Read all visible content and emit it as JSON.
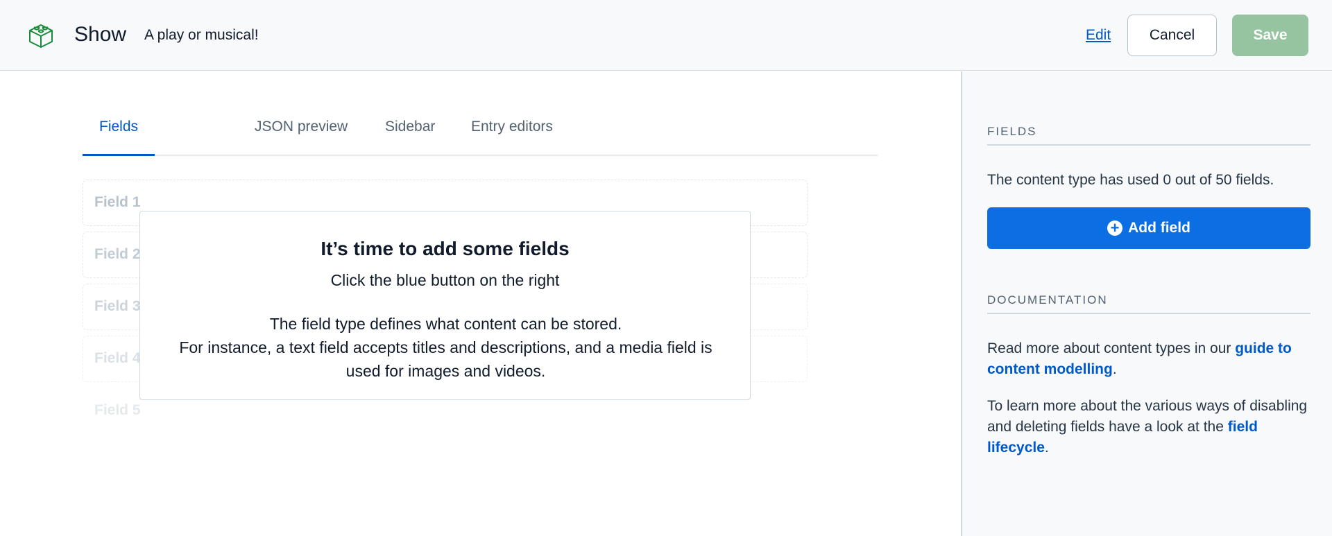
{
  "header": {
    "title": "Show",
    "subtitle": "A play or musical!",
    "edit_label": "Edit",
    "cancel_label": "Cancel",
    "save_label": "Save",
    "logo_icon": "content-type-box-icon"
  },
  "tabs": [
    {
      "label": "Fields",
      "active": true
    },
    {
      "label": "JSON preview",
      "active": false
    },
    {
      "label": "Sidebar",
      "active": false
    },
    {
      "label": "Entry editors",
      "active": false
    }
  ],
  "placeholder_fields": [
    "Field 1",
    "Field 2",
    "Field 3",
    "Field 4",
    "Field 5"
  ],
  "empty_state": {
    "heading": "It’s time to add some fields",
    "subheading": "Click the blue button on the right",
    "description_1": "The field type defines what content can be stored.",
    "description_2": "For instance, a text field accepts titles and descriptions, and a media field is used for images and videos."
  },
  "sidebar": {
    "fields_heading": "FIELDS",
    "fields_usage": "The content type has used 0 out of 50 fields.",
    "add_field_label": "Add field",
    "documentation_heading": "DOCUMENTATION",
    "doc_text_1_before": "Read more about content types in our ",
    "doc_link_1": "guide to content modelling",
    "doc_text_1_after": ".",
    "doc_text_2_before": "To learn more about the various ways of disabling and deleting fields have a look at the ",
    "doc_link_2": "field lifecycle",
    "doc_text_2_after": "."
  },
  "colors": {
    "accent_blue": "#0b6fe3",
    "link_blue": "#0059c8",
    "save_disabled_green": "#96c4a0",
    "logo_green": "#1a8b3a"
  }
}
